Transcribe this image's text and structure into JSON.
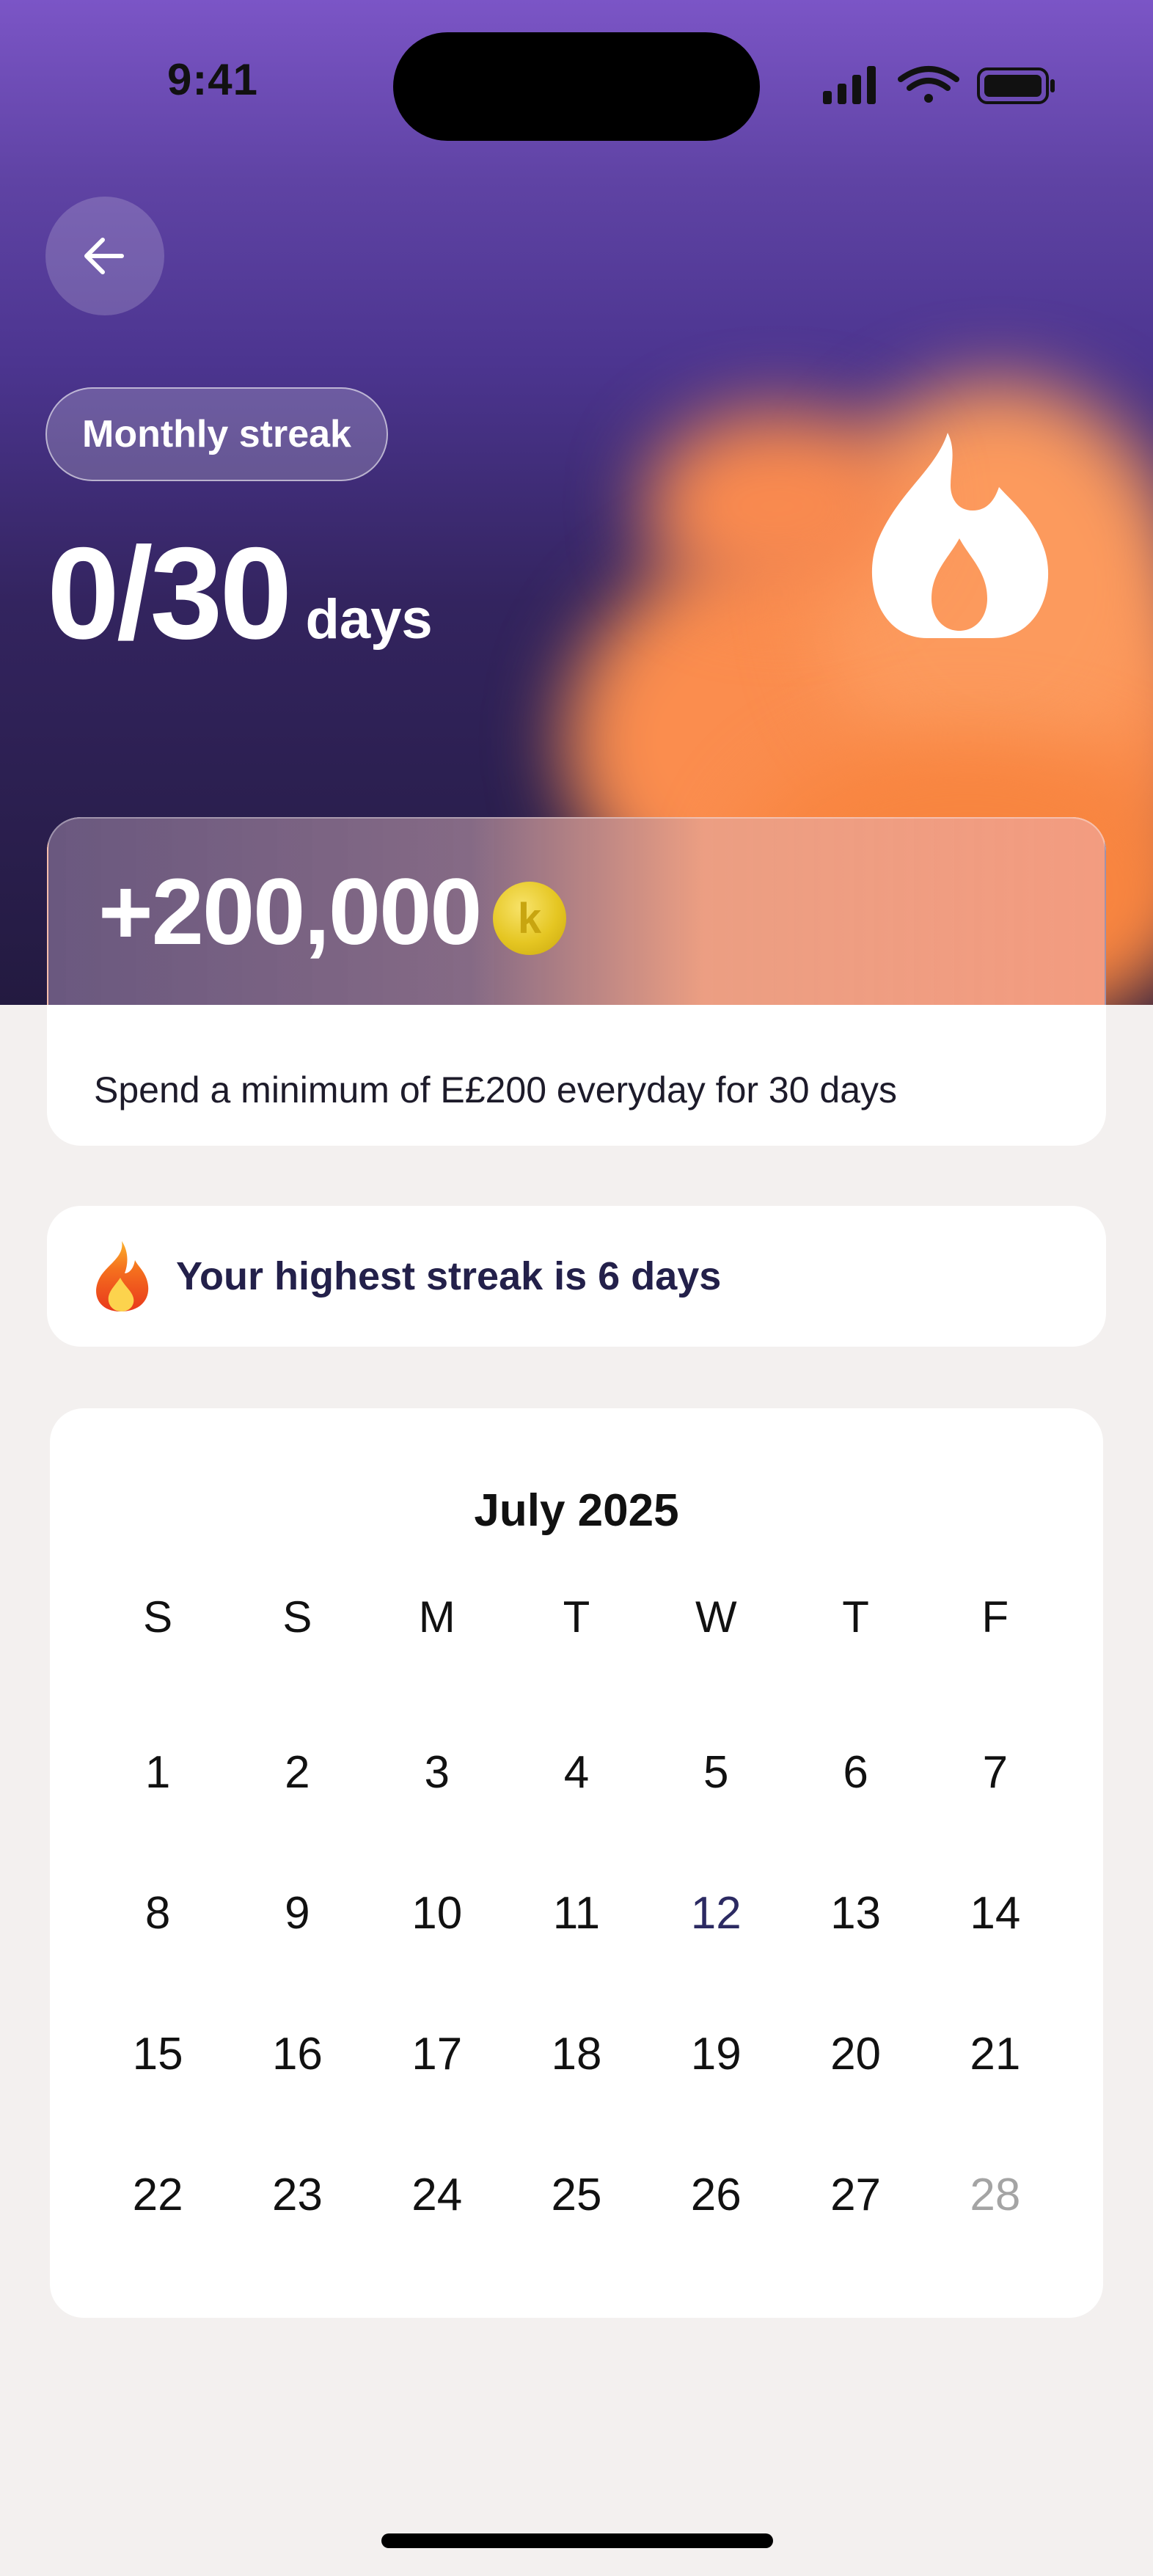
{
  "status_bar": {
    "time": "9:41"
  },
  "header": {
    "badge": "Monthly streak",
    "progress": "0/30",
    "unit": "days"
  },
  "reward": {
    "amount": "+200,000",
    "coin_symbol": "k",
    "description": "Spend a minimum of E£200 everyday for 30 days"
  },
  "highest_streak": {
    "text": "Your highest streak is 6 days"
  },
  "calendar": {
    "month": "July 2025",
    "weekdays": [
      "S",
      "S",
      "M",
      "T",
      "W",
      "T",
      "F"
    ],
    "days": [
      "1",
      "2",
      "3",
      "4",
      "5",
      "6",
      "7",
      "8",
      "9",
      "10",
      "11",
      "12",
      "13",
      "14",
      "15",
      "16",
      "17",
      "18",
      "19",
      "20",
      "21",
      "22",
      "23",
      "24",
      "25",
      "26",
      "27",
      "28"
    ],
    "today": "12",
    "future_from": "28"
  },
  "colors": {
    "hero_top": "#7b55c6",
    "hero_bottom": "#231a40",
    "accent_orange": "#fb8d4e",
    "coin_gold": "#e5c622",
    "background": "#f3f0ef"
  },
  "icons": {
    "back": "arrow-left-icon",
    "flame": "flame-icon",
    "fire_emoji": "fire-emoji-icon",
    "coin": "coin-icon",
    "signal": "cellular-signal-icon",
    "wifi": "wifi-icon",
    "battery": "battery-icon"
  }
}
